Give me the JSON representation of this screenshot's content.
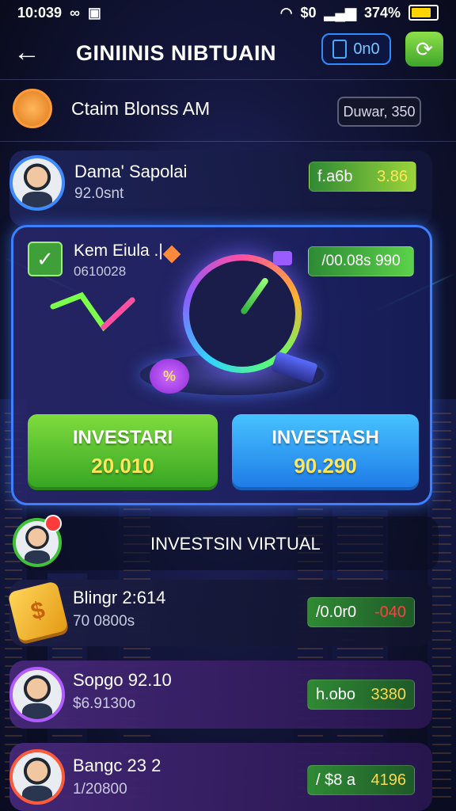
{
  "status": {
    "time": "10:039",
    "icons_left": "∞",
    "signal": "$0",
    "battery": "374%"
  },
  "header": {
    "title": "GINIINIS NIBTUAIN",
    "badge": "0n0"
  },
  "claim": {
    "text": "Ctaim Blonss AM",
    "pill": "Duwar, 350"
  },
  "user_card": {
    "name": "Dama' Sapolai",
    "sub": "92.0snt",
    "pill_left": "f.a6b",
    "pill_right": "3.86"
  },
  "hero": {
    "name": "Kem Eiula .|",
    "sub": "0610028",
    "pill": "/00.08s 990",
    "badge": "%",
    "buttons": [
      {
        "label": "INVESTARI",
        "amount": "20.010"
      },
      {
        "label": "INVESTASH",
        "amount": "90.290"
      }
    ]
  },
  "section": {
    "title": "INVESTSIN VIRTUAL"
  },
  "rows": [
    {
      "name": "Blingr 2:614",
      "sub": "70 0800s",
      "pill_left": "/0.0r0",
      "pill_right": "-040",
      "color": "#ff4040"
    },
    {
      "name": "Sopgo 92.10",
      "sub": "$6.9130o",
      "pill_left": "h.obo",
      "pill_right": "3380",
      "color": "#ffd84a"
    },
    {
      "name": "Bangc 23 2",
      "sub": "1/20800",
      "pill_left": "/ $8 a",
      "pill_right": "4196",
      "color": "#ffd84a"
    }
  ],
  "colors": {
    "accent_blue": "#3d7fff",
    "accent_green": "#3ea62a",
    "bg": "#14173e"
  }
}
